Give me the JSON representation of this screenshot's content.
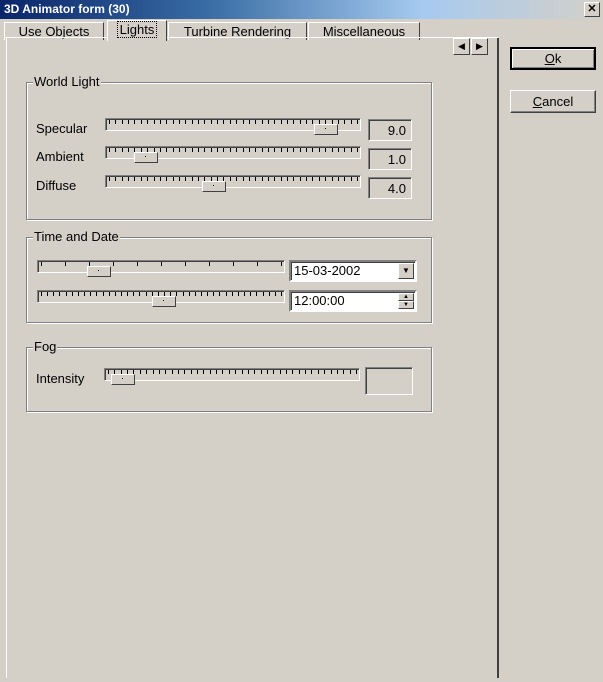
{
  "window": {
    "title": "3D Animator form  (30)",
    "close_label": "✕"
  },
  "tabs": [
    {
      "label": "Use Objects"
    },
    {
      "label": "Lights"
    },
    {
      "label": "Turbine Rendering"
    },
    {
      "label": "Miscellaneous"
    }
  ],
  "tab_scroll": {
    "left": "◀",
    "right": "▶"
  },
  "world_light": {
    "title": "World Light",
    "specular": {
      "label": "Specular",
      "value": "9.0",
      "level": 0.9
    },
    "ambient": {
      "label": "Ambient",
      "value": "1.0",
      "level": 0.1
    },
    "diffuse": {
      "label": "Diffuse",
      "value": "4.0",
      "level": 0.4
    }
  },
  "time_date": {
    "title": "Time and Date",
    "date_value": "15-03-2002",
    "time_value": "12:00:00",
    "date_slider_level": 0.2,
    "time_slider_level": 0.5
  },
  "fog": {
    "title": "Fog",
    "intensity_label": "Intensity",
    "intensity_value": "",
    "intensity_level": 0.0
  },
  "buttons": {
    "ok_prefix": "O",
    "ok_rest": "k",
    "cancel_prefix": "C",
    "cancel_rest": "ancel"
  },
  "icons": {
    "close": "close-icon",
    "dropdown": "chevron-down-icon",
    "spin_up": "spin-up-icon",
    "spin_down": "spin-down-icon"
  }
}
